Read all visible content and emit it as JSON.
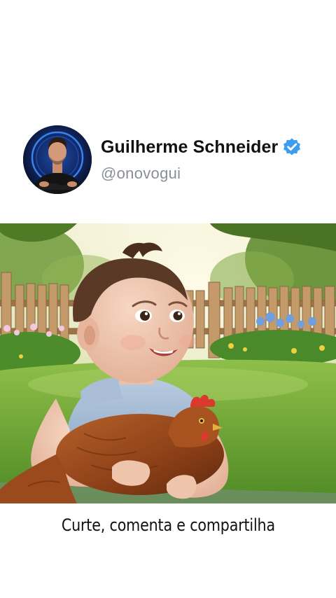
{
  "profile": {
    "name": "Guilherme Schneider",
    "handle": "@onovogui",
    "verified": true,
    "verified_color": "#3b9cf0",
    "avatar_icon": "profile-photo"
  },
  "media": {
    "image_icon": "baby-with-hen-illustration"
  },
  "caption": {
    "text": "Curte, comenta e compartilha"
  }
}
